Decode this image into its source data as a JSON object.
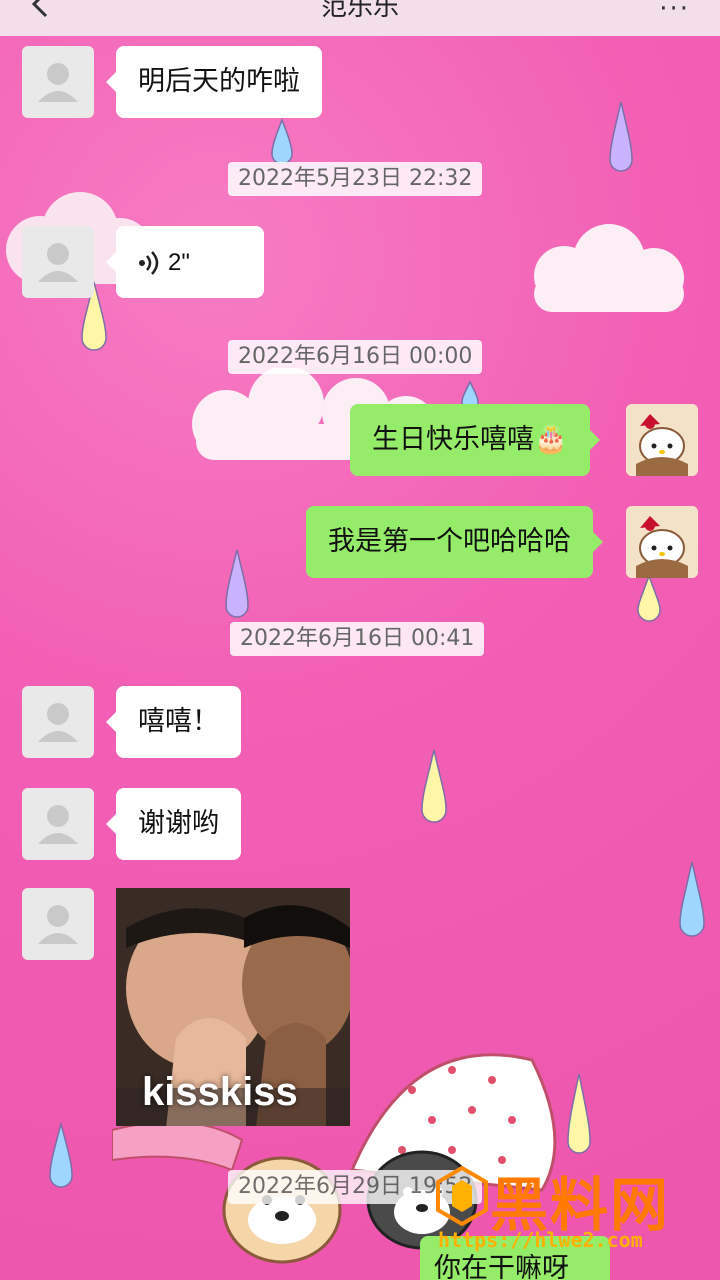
{
  "header": {
    "title": "范乐乐",
    "more_label": "···"
  },
  "messages": [
    {
      "text": "明后天的咋啦"
    },
    {
      "voice_duration": "2\""
    },
    {
      "text": "生日快乐嘻嘻🎂"
    },
    {
      "text": "我是第一个吧哈哈哈"
    },
    {
      "text": "嘻嘻！"
    },
    {
      "text": "谢谢哟"
    },
    {
      "image_caption": "kisskiss"
    },
    {
      "text": "你在干嘛呀"
    }
  ],
  "timestamps": [
    "2022年5月23日 22:32",
    "2022年6月16日 00:00",
    "2022年6月16日 00:41",
    "2022年6月29日 19:52"
  ],
  "watermark": {
    "text": "黑料网",
    "url": "https://hlwe2.com"
  },
  "colors": {
    "background": "#f25fb4",
    "bubble_self": "#95ec69",
    "bubble_other": "#ffffff"
  }
}
